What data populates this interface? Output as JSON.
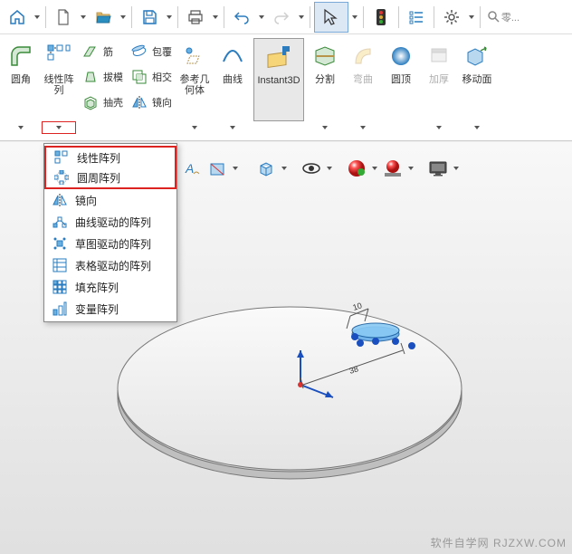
{
  "top": {
    "search_placeholder": "零..."
  },
  "ribbon": {
    "big": {
      "fillet": "圆角",
      "linear_pattern": "线性阵\n列",
      "ref_geom": "参考几\n何体",
      "curve": "曲线",
      "instant3d": "Instant3D",
      "split": "分割",
      "bend": "弯曲",
      "dome": "圆顶",
      "thicken": "加厚",
      "move_face": "移动面"
    },
    "small": {
      "rib": "筋",
      "wrap": "包覆",
      "draft": "拔模",
      "intersect": "相交",
      "shell": "抽壳",
      "mirror": "镜向"
    }
  },
  "dropdown": {
    "linear": "线性阵列",
    "circular": "圆周阵列",
    "mirror": "镜向",
    "curve_driven": "曲线驱动的阵列",
    "sketch_driven": "草图驱动的阵列",
    "table_driven": "表格驱动的阵列",
    "fill": "填充阵列",
    "variable": "变量阵列"
  },
  "dims": {
    "d1": "10",
    "d2": "38"
  },
  "watermark": "软件自学网 RJZXW.COM"
}
